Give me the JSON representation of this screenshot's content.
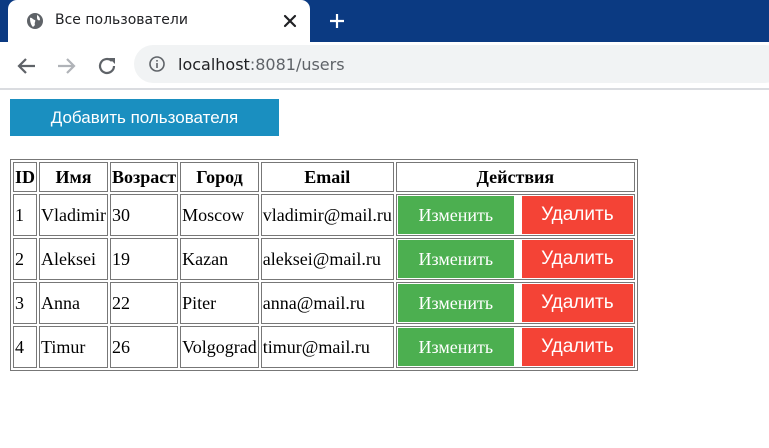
{
  "browser": {
    "tab_title": "Все пользователи",
    "url_host": "localhost",
    "url_rest": ":8081/users"
  },
  "page": {
    "add_button_label": "Добавить пользователя",
    "table": {
      "headers": [
        "ID",
        "Имя",
        "Возраст",
        "Город",
        "Email",
        "Действия"
      ],
      "rows": [
        {
          "id": "1",
          "name": "Vladimir",
          "age": "30",
          "city": "Moscow",
          "email": "vladimir@mail.ru"
        },
        {
          "id": "2",
          "name": "Aleksei",
          "age": "19",
          "city": "Kazan",
          "email": "aleksei@mail.ru"
        },
        {
          "id": "3",
          "name": "Anna",
          "age": "22",
          "city": "Piter",
          "email": "anna@mail.ru"
        },
        {
          "id": "4",
          "name": "Timur",
          "age": "26",
          "city": "Volgograd",
          "email": "timur@mail.ru"
        }
      ],
      "edit_label": "Изменить",
      "delete_label": "Удалить"
    }
  },
  "colors": {
    "tabbar": "#0b3a82",
    "add_button": "#1a8fc0",
    "edit_button": "#4caf50",
    "delete_button": "#f44336"
  },
  "icons": [
    "globe-icon",
    "close-icon",
    "plus-icon",
    "back-arrow-icon",
    "forward-arrow-icon",
    "reload-icon",
    "info-icon"
  ]
}
